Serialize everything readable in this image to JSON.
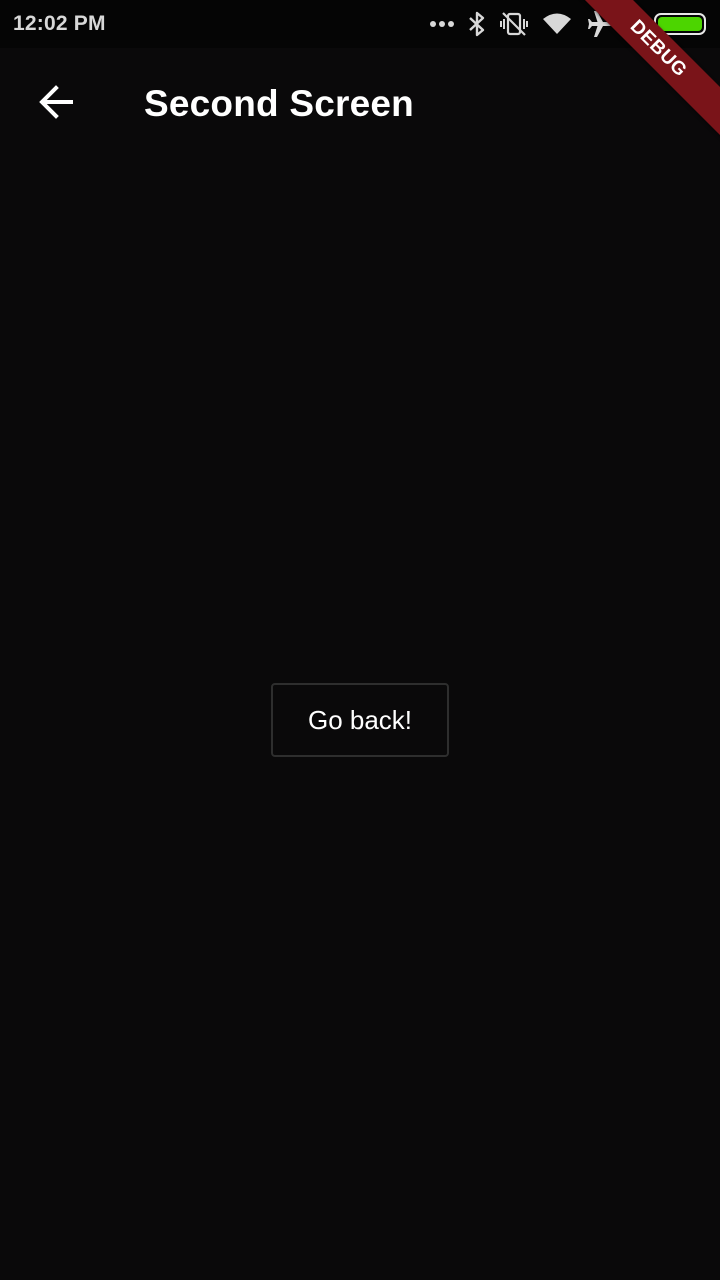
{
  "status_bar": {
    "time": "12:02 PM",
    "icons": [
      "more-dots-icon",
      "bluetooth-icon",
      "vibrate-off-icon",
      "wifi-icon",
      "airplane-icon",
      "charging-icon",
      "battery-icon"
    ]
  },
  "app_bar": {
    "title": "Second Screen",
    "back_icon": "arrow-back-icon"
  },
  "main": {
    "button_label": "Go back!"
  },
  "debug_banner": {
    "label": "DEBUG"
  },
  "colors": {
    "background": "#0a090a",
    "status_bar": "#050505",
    "battery": "#4cd500",
    "debug_banner": "#7a1419",
    "button_border": "#2e2e2e"
  }
}
